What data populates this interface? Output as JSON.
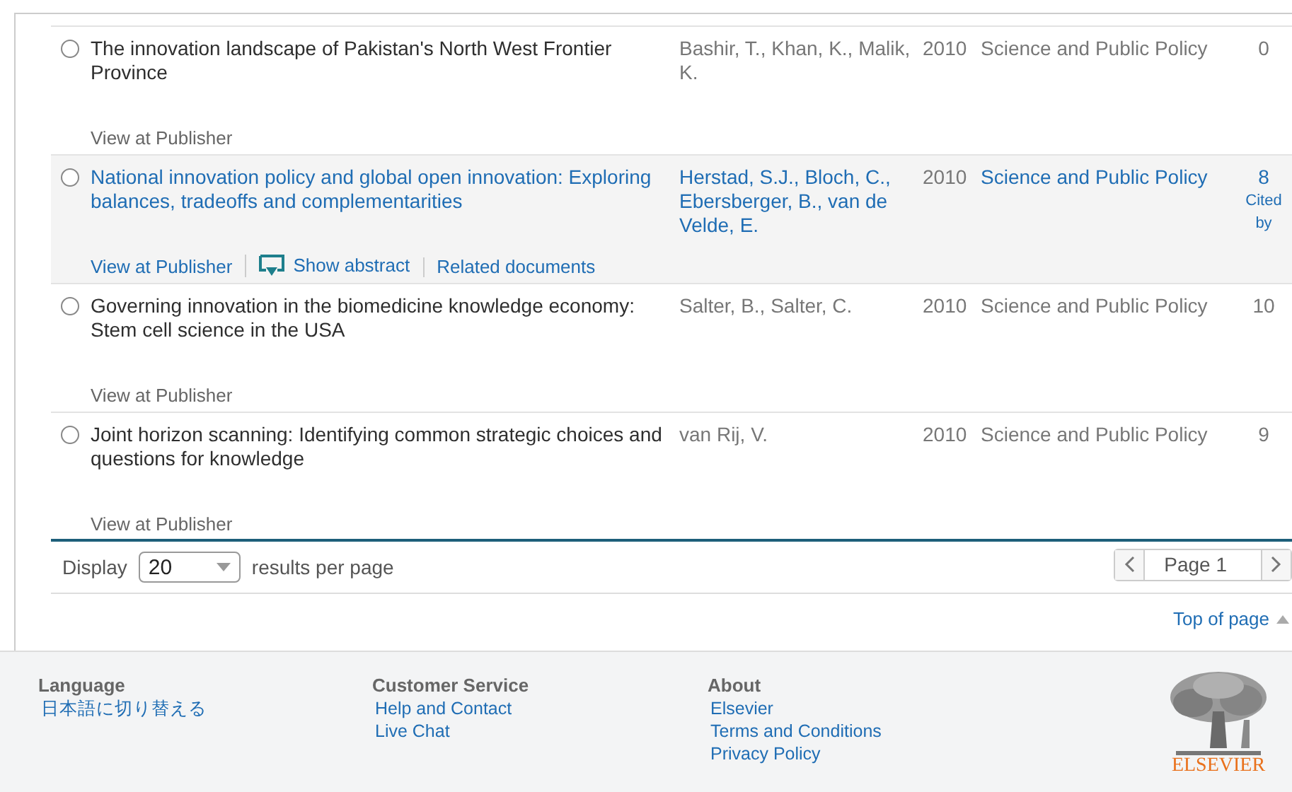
{
  "results": [
    {
      "title": "The innovation landscape of Pakistan's North West Frontier Province",
      "authors": "Bashir, T., Khan, K., Malik, K.",
      "year": "2010",
      "source": "Science and Public Policy",
      "cited": "0",
      "highlighted": false,
      "checked": false,
      "actions": [
        {
          "kind": "link",
          "label": "View at Publisher"
        }
      ]
    },
    {
      "title": "National innovation policy and global open innovation: Exploring balances, tradeoffs and complementarities",
      "authors": "Herstad, S.J., Bloch, C., Ebersberger, B., van de Velde, E.",
      "year": "2010",
      "source": "Science and Public Policy",
      "cited": "8",
      "cited_label": "Cited by",
      "highlighted": true,
      "checked": false,
      "actions": [
        {
          "kind": "link",
          "label": "View at Publisher"
        },
        {
          "kind": "abstract",
          "label": "Show abstract"
        },
        {
          "kind": "link",
          "label": "Related documents"
        }
      ]
    },
    {
      "title": "Governing innovation in the biomedicine knowledge economy: Stem cell science in the USA",
      "authors": "Salter, B., Salter, C.",
      "year": "2010",
      "source": "Science and Public Policy",
      "cited": "10",
      "highlighted": false,
      "checked": false,
      "actions": [
        {
          "kind": "link",
          "label": "View at Publisher"
        }
      ]
    },
    {
      "title": "Joint horizon scanning: Identifying common strategic choices and questions for knowledge",
      "authors": "van Rij, V.",
      "year": "2010",
      "source": "Science and Public Policy",
      "cited": "9",
      "highlighted": false,
      "checked": false,
      "actions": [
        {
          "kind": "link",
          "label": "View at Publisher"
        }
      ]
    }
  ],
  "pagination": {
    "display_label": "Display",
    "per_page": "20",
    "per_page_suffix": "results per page",
    "page": "Page 1"
  },
  "top_link": "Top of page",
  "footer": {
    "columns": [
      {
        "heading": "Language",
        "links": [
          "日本語に切り替える"
        ]
      },
      {
        "heading": "Customer Service",
        "links": [
          "Help and Contact",
          "Live Chat"
        ]
      },
      {
        "heading": "About",
        "links": [
          "Elsevier",
          "Terms and Conditions",
          "Privacy Policy"
        ]
      }
    ],
    "logo_text": "ELSEVIER"
  }
}
